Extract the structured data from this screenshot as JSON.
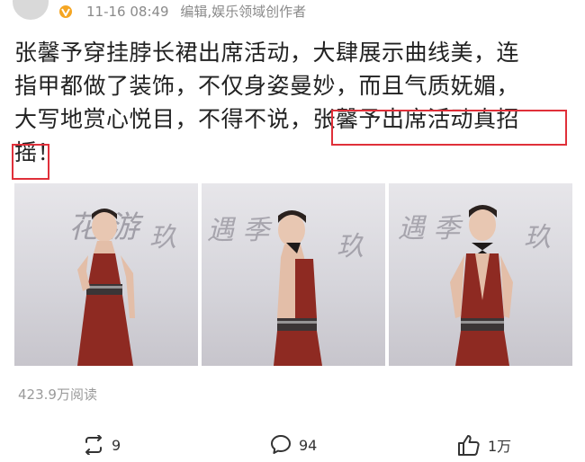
{
  "post": {
    "time": "11-16 08:49",
    "author_label": "编辑,娱乐领域创作者",
    "text_line1": "张馨予穿挂脖长裙出席活动，大肆展示曲线美，连",
    "text_line2": "指甲都做了装饰，不仅身姿曼妙，而且气质妩媚，",
    "text_line3": "大写地赏心悦目，不得不说，张馨予出席活动真招",
    "text_line4": "摇！",
    "views": "423.9万阅读"
  },
  "photos": [
    {
      "name": "photo-1"
    },
    {
      "name": "photo-2"
    },
    {
      "name": "photo-3"
    }
  ],
  "actions": {
    "repost_count": "9",
    "comment_count": "94",
    "like_count": "1万"
  },
  "colors": {
    "highlight_border": "#e0303a",
    "badge": "#f5a623",
    "dress": "#8e2a22",
    "meta_text": "#8a8a8a"
  },
  "icons": [
    "verified-badge-icon",
    "repost-icon",
    "comment-icon",
    "like-icon"
  ]
}
